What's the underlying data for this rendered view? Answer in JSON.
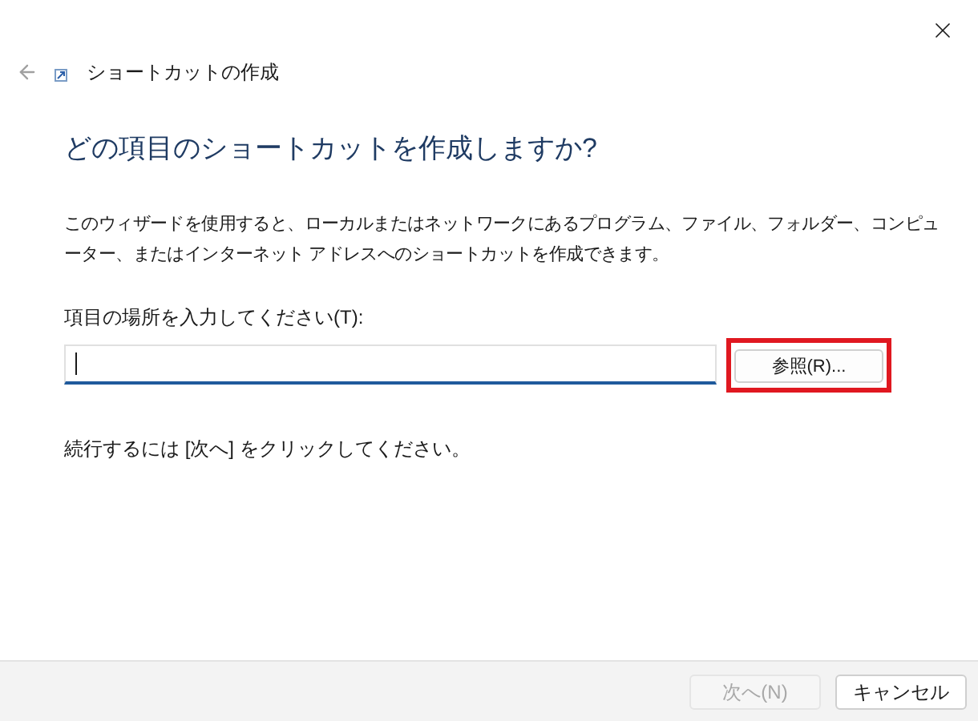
{
  "window": {
    "title": "ショートカットの作成"
  },
  "heading": "どの項目のショートカットを作成しますか?",
  "description": "このウィザードを使用すると、ローカルまたはネットワークにあるプログラム、ファイル、フォルダー、コンピューター、またはインターネット アドレスへのショートカットを作成できます。",
  "location": {
    "label": "項目の場所を入力してください(T):"
  },
  "browse_button": {
    "label": "参照(R)...",
    "highlighted": true
  },
  "hint": "続行するには [次へ] をクリックしてください。",
  "buttons": [
    {
      "label": "次へ(N)",
      "disabled": true
    },
    {
      "label": "キャンセル",
      "disabled": false
    }
  ]
}
